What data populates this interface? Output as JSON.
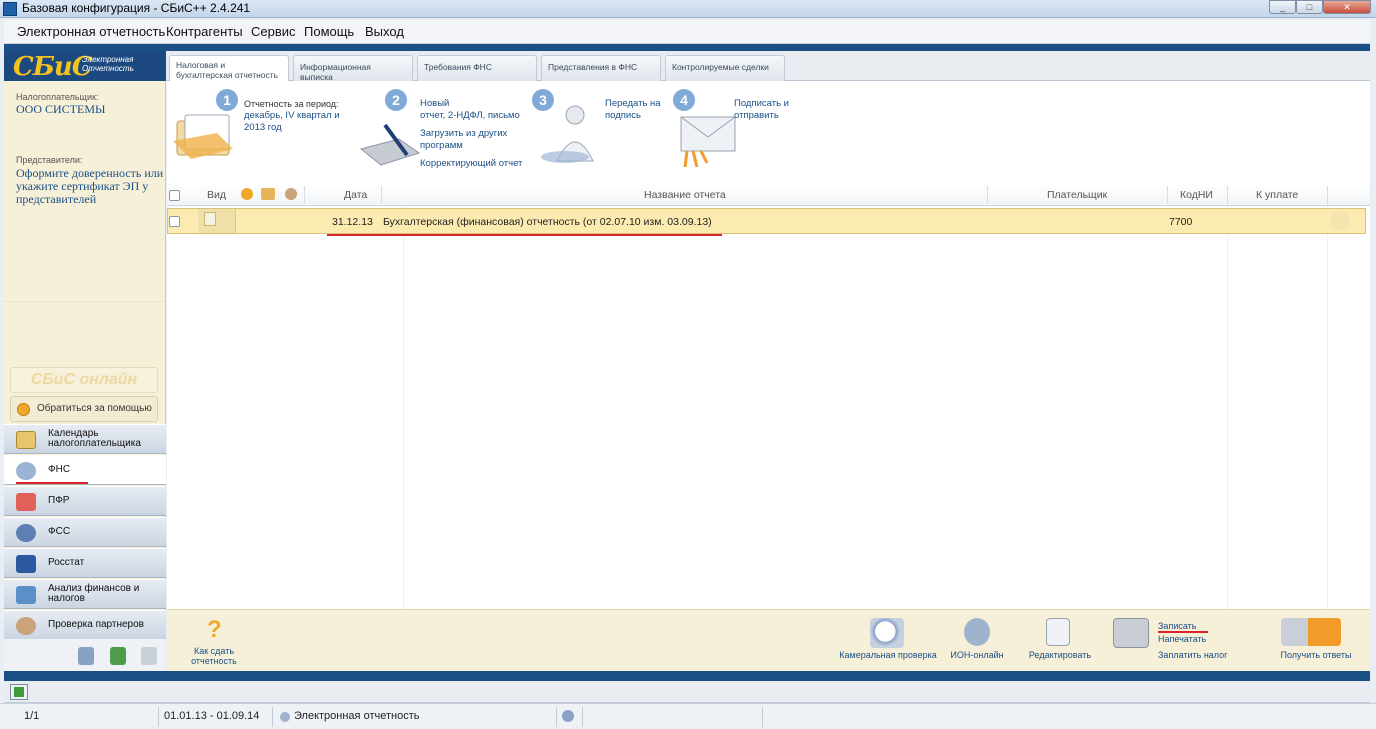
{
  "window": {
    "title": "Базовая конфигурация - СБиС++ 2.4.241"
  },
  "menu": [
    "Электронная отчетность",
    "Контрагенты",
    "Сервис",
    "Помощь",
    "Выход"
  ],
  "logo": {
    "brand": "СБиС",
    "sub1": "Электронная",
    "sub2": "Отчетность"
  },
  "taxpayer": {
    "label": "Налогоплательщик:",
    "name": "ООО СИСТЕМЫ"
  },
  "representatives": {
    "label": "Представители:",
    "text": "Оформите доверенность или укажите сертификат ЭП у представителей"
  },
  "online_logo": "СБиС онлайн",
  "help_button": "Обратиться за помощью",
  "nav": [
    {
      "label": "Календарь налогоплательщика",
      "icon": "calendar-icon"
    },
    {
      "label": "ФНС",
      "icon": "fns-emblem-icon"
    },
    {
      "label": "ПФР",
      "icon": "pfr-icon"
    },
    {
      "label": "ФСС",
      "icon": "fss-icon"
    },
    {
      "label": "Росстат",
      "icon": "rosstat-icon"
    },
    {
      "label": "Анализ финансов и налогов",
      "icon": "analysis-icon"
    },
    {
      "label": "Проверка партнеров",
      "icon": "partners-check-icon"
    }
  ],
  "tabs": [
    "Налоговая и бухгалтерская отчетность",
    "Информационная выписка",
    "Требования ФНС",
    "Представления в ФНС",
    "Контролируемые сделки"
  ],
  "steps": [
    {
      "num": "1",
      "l1": "Отчетность за период:",
      "l2": "декабрь, IV квартал и",
      "l3": "2013 год"
    },
    {
      "num": "2",
      "l1": "Новый",
      "l2": "отчет, 2-НДФЛ, письмо",
      "l3": "Загрузить из других",
      "l4": "программ",
      "l5": "Корректирующий отчет"
    },
    {
      "num": "3",
      "l1": "Передать на",
      "l2": "подпись"
    },
    {
      "num": "4",
      "l1": "Подписать и",
      "l2": "отправить"
    }
  ],
  "grid": {
    "headers": [
      "Вид",
      "Дата",
      "Название отчета",
      "Плательщик",
      "КодНИ",
      "К уплате"
    ],
    "rows": [
      {
        "date": "31.12.13",
        "name": "Бухгалтерская (финансовая) отчетность (от 02.07.10 изм. 03.09.13)",
        "payer": "",
        "code": "7700",
        "due": ""
      }
    ]
  },
  "toolbar": {
    "how_to": "Как сдать отчетность",
    "camera_check": "Камеральная проверка",
    "ion": "ИОН-онлайн",
    "edit": "Редактировать",
    "save": "Записать",
    "print": "Напечатать",
    "pay": "Заплатить налог",
    "get_answers": "Получить ответы"
  },
  "status": {
    "page": "1/1",
    "period": "01.01.13 - 01.09.14",
    "mode": "Электронная отчетность"
  },
  "colors": {
    "accent": "#1a4f86",
    "row_highlight": "#fcebb0",
    "underline": "#d8242a"
  }
}
